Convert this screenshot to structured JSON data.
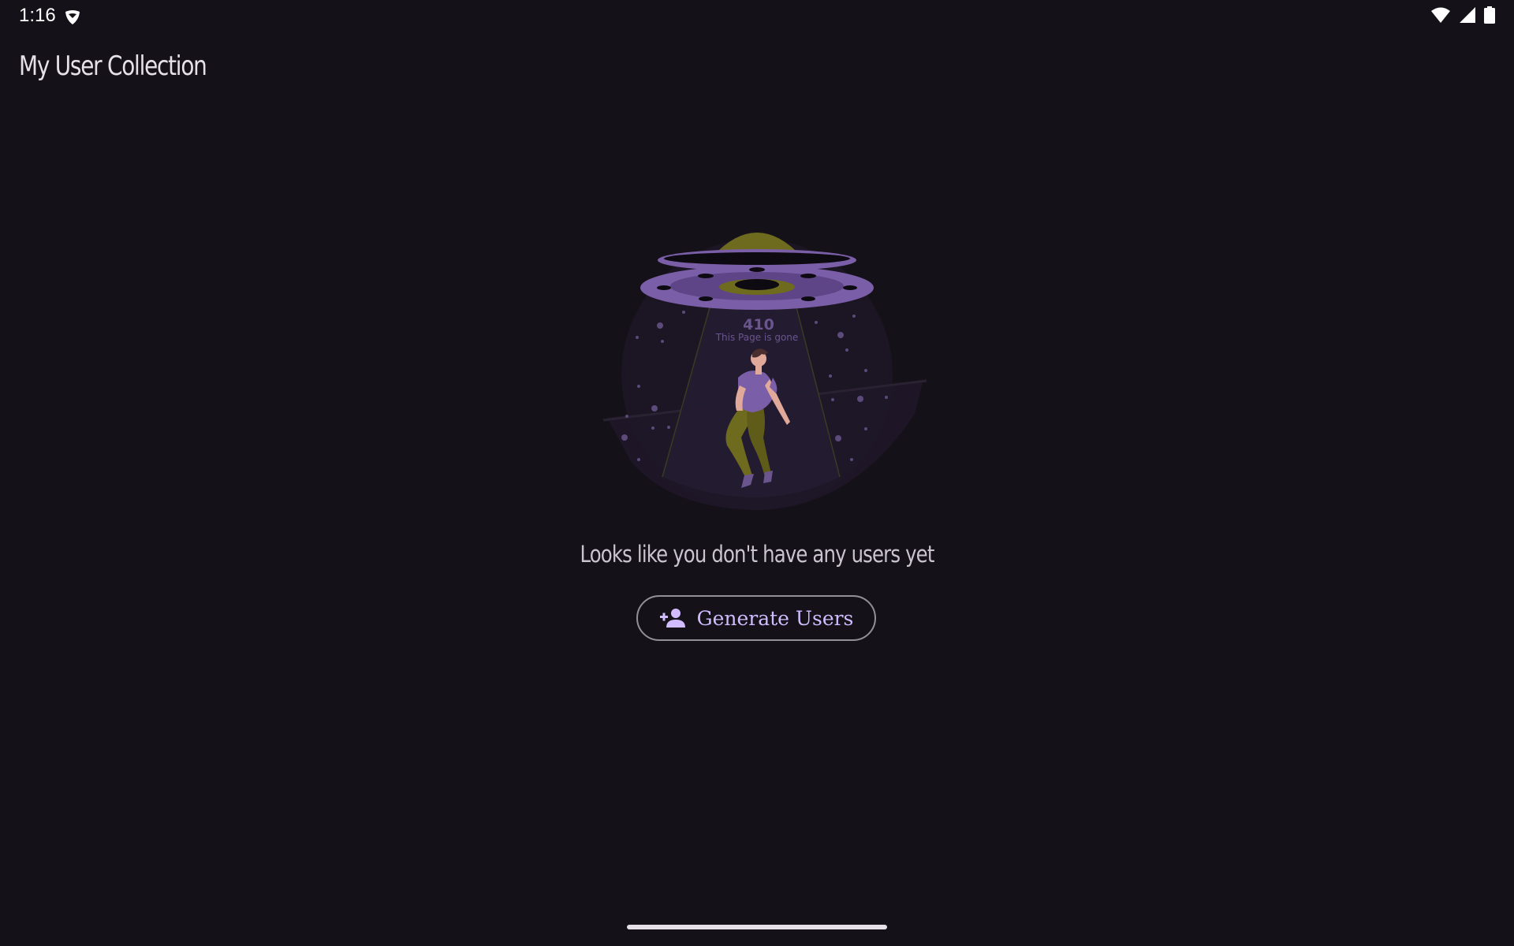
{
  "status_bar": {
    "time": "1:16",
    "app_icon": "shield-notification-icon",
    "icons": [
      "wifi-icon",
      "cellular-signal-icon",
      "battery-icon"
    ]
  },
  "app_bar": {
    "title": "My User Collection"
  },
  "empty_state": {
    "illustration": {
      "code": "410",
      "caption": "This Page is gone"
    },
    "message": "Looks like you don't have any users yet",
    "button": {
      "label": "Generate Users",
      "icon": "person-add-icon"
    }
  },
  "colors": {
    "background": "#141218",
    "accent": "#d0bcff",
    "illustration_purple": "#7b5ea8",
    "illustration_olive": "#6e6a1e"
  }
}
